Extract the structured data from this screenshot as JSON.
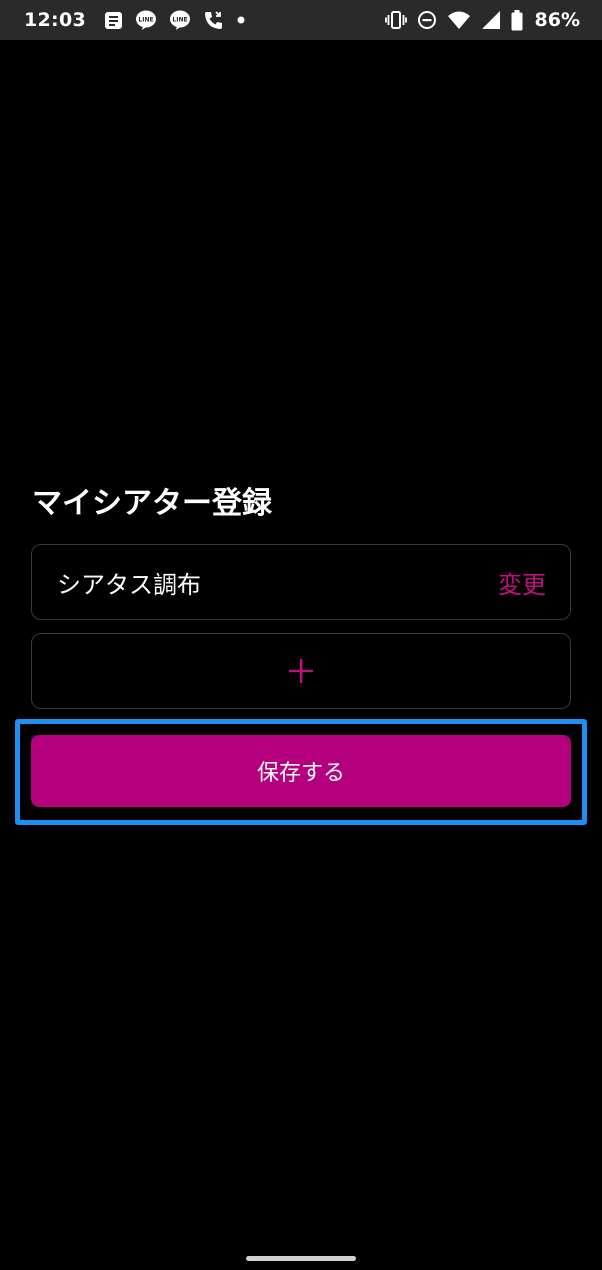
{
  "status_bar": {
    "time": "12:03",
    "left_icons": [
      "message-icon",
      "line-app-icon",
      "line-app-icon",
      "phone-call-icon",
      "dot-icon"
    ],
    "right_icons": [
      "vibrate-icon",
      "do-not-disturb-icon",
      "wifi-icon",
      "cell-signal-icon",
      "battery-icon"
    ],
    "battery": "86%"
  },
  "form": {
    "title": "マイシアター登録",
    "theater_name": "シアタス調布",
    "change_label": "変更",
    "add_label": "+",
    "save_label": "保存する"
  },
  "colors": {
    "background": "#000000",
    "accent": "#b5007e",
    "link": "#c0107f",
    "highlight": "#1e8ff5"
  }
}
